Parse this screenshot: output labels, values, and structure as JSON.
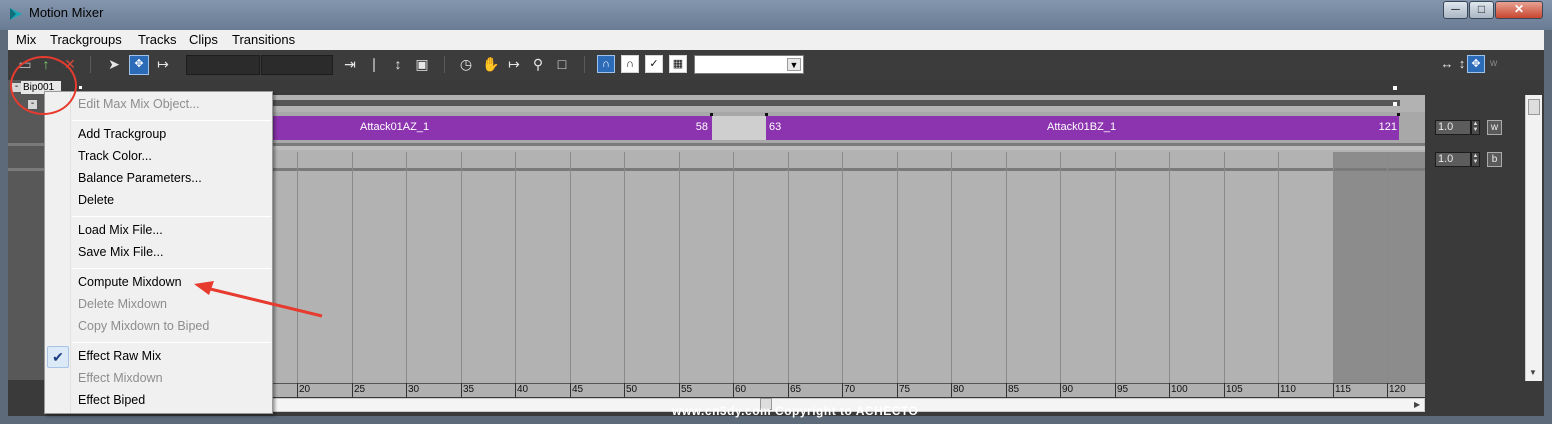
{
  "window": {
    "title": "Motion Mixer"
  },
  "menubar": [
    "Mix",
    "Trackgroups",
    "Tracks",
    "Clips",
    "Transitions"
  ],
  "toolbar": {
    "dropdown_value": ""
  },
  "tree": {
    "node_label": "Bip001"
  },
  "tracks": [
    {
      "clips": [
        {
          "name": "Attack01AZ_1",
          "end_frame": "58"
        },
        {
          "name": "Attack01BZ_1",
          "start_frame": "63",
          "end_frame": "121"
        }
      ],
      "weight_value": "1.0",
      "weight_button": "w"
    },
    {
      "weight_value": "1.0",
      "weight_button": "b"
    }
  ],
  "ruler": {
    "ticks": [
      "20",
      "25",
      "30",
      "35",
      "40",
      "45",
      "50",
      "55",
      "60",
      "65",
      "70",
      "75",
      "80",
      "85",
      "90",
      "95",
      "100",
      "105",
      "110",
      "115",
      "120"
    ]
  },
  "context_menu": {
    "items": [
      {
        "label": "Edit Max Mix Object...",
        "enabled": false
      },
      {
        "label": "Add Trackgroup",
        "enabled": true
      },
      {
        "label": "Track Color...",
        "enabled": true
      },
      {
        "label": "Balance Parameters...",
        "enabled": true
      },
      {
        "label": "Delete",
        "enabled": true
      },
      {
        "label": "Load Mix File...",
        "enabled": true
      },
      {
        "label": "Save Mix File...",
        "enabled": true
      },
      {
        "label": "Compute Mixdown",
        "enabled": true
      },
      {
        "label": "Delete Mixdown",
        "enabled": false
      },
      {
        "label": "Copy Mixdown to Biped",
        "enabled": false
      },
      {
        "label": "Effect Raw Mix",
        "enabled": true,
        "checked": true
      },
      {
        "label": "Effect Mixdown",
        "enabled": false
      },
      {
        "label": "Effect Biped",
        "enabled": true
      }
    ]
  },
  "right_controls": {
    "w_label": "w"
  },
  "watermark": "www.cn3dy.com Copyright to ACHECTO",
  "colors": {
    "clip": "#8c33b0",
    "annotation": "#e63b2e"
  }
}
